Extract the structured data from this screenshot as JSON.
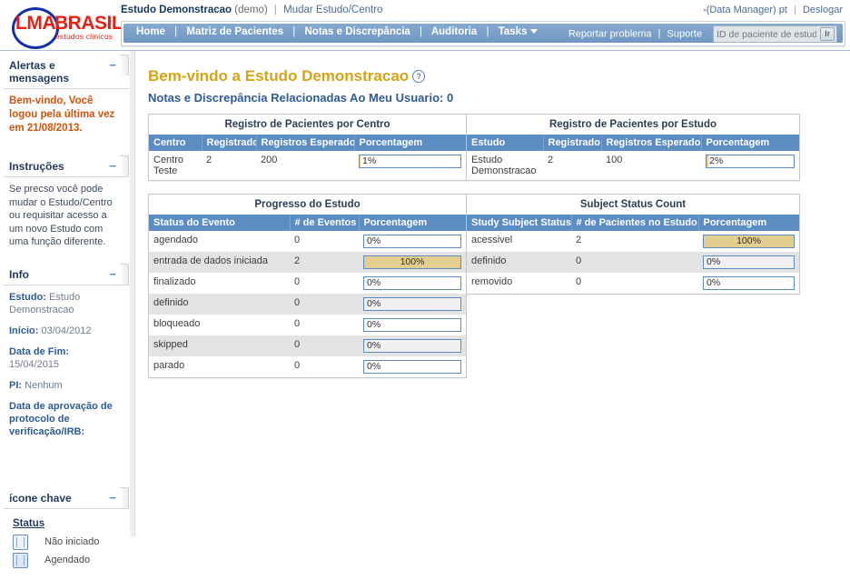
{
  "brand": {
    "logo_main": "LMA",
    "logo_second": "BRASIL",
    "logo_sub": "estudos clinicos",
    "circle_color": "#1231a8",
    "text_color": "#e81f14"
  },
  "header": {
    "study_name": "Estudo Demonstracao",
    "study_demo": "(demo)",
    "separator": "|",
    "change_study_link": "Mudar Estudo/Centro",
    "data_manager": "(Data Manager)",
    "language": "pt",
    "logout": "Deslogar"
  },
  "nav": {
    "items": [
      {
        "label": "Home"
      },
      {
        "label": "Matriz de Pacientes"
      },
      {
        "label": "Notas e Discrepância"
      },
      {
        "label": "Auditoria"
      },
      {
        "label": "Tasks",
        "has_caret": true
      }
    ],
    "separator": "|",
    "report_problem": "Reportar problema",
    "support": "Suporte",
    "search_placeholder": "ID de paciente de estudo",
    "search_value": "",
    "go_label": "Ir"
  },
  "sidebar": {
    "alerts": {
      "title": "Alertas e mensagens",
      "minus": "−",
      "text": "Bem-vindo, Você logou pela última vez em 21/08/2013."
    },
    "instructions": {
      "title": "Instruções",
      "minus": "−",
      "text": "Se precso você pode mudar o Estudo/Centro ou requisitar acesso a um novo Estudo com uma função diferente."
    },
    "info": {
      "title": "Info",
      "minus": "−",
      "rows": [
        {
          "label": "Estudo:",
          "value": "Estudo Demonstracao"
        },
        {
          "label": "Início:",
          "value": "03/04/2012"
        },
        {
          "label": "Data de Fim:",
          "value": "15/04/2015"
        },
        {
          "label": "PI:",
          "value": "Nenhum"
        }
      ],
      "irb_label": "Data de aprovação de protocolo de verificação/IRB:"
    },
    "key": {
      "title": "ícone chave",
      "minus": "−",
      "status_header": "Status",
      "legend": [
        {
          "icon": "not-started-icon",
          "label": "Não iniciado"
        },
        {
          "icon": "scheduled-icon",
          "label": "Agendado"
        }
      ]
    }
  },
  "main": {
    "welcome_title": "Bem-vindo a Estudo Demonstracao",
    "help_icon": "?",
    "subtitle": "Notas e Discrepância Relacionadas Ao Meu Usuario: 0"
  },
  "tables": {
    "by_center": {
      "title": "Registro de Pacientes por Centro",
      "columns": [
        "Centro",
        "Registrado",
        "Registros Esperados",
        "Porcentagem"
      ],
      "rows": [
        {
          "centro": "Centro Teste",
          "registrado": "2",
          "esperados": "200",
          "porcentagem": "1%",
          "pct_value": 1
        }
      ]
    },
    "by_study": {
      "title": "Registro de Pacientes por Estudo",
      "columns": [
        "Estudo",
        "Registrado",
        "Registros Esperados",
        "Porcentagem"
      ],
      "rows": [
        {
          "estudo": "Estudo Demonstracao",
          "registrado": "2",
          "esperados": "100",
          "porcentagem": "2%",
          "pct_value": 2
        }
      ]
    },
    "progress": {
      "title": "Progresso do Estudo",
      "columns": [
        "Status do Evento",
        "# de Eventos",
        "Porcentagem"
      ],
      "rows": [
        {
          "status": "agendado",
          "eventos": "0",
          "porcentagem": "0%",
          "pct_value": 0
        },
        {
          "status": "entrada de dados iniciada",
          "eventos": "2",
          "porcentagem": "100%",
          "pct_value": 100
        },
        {
          "status": "finalizado",
          "eventos": "0",
          "porcentagem": "0%",
          "pct_value": 0
        },
        {
          "status": "definido",
          "eventos": "0",
          "porcentagem": "0%",
          "pct_value": 0
        },
        {
          "status": "bloqueado",
          "eventos": "0",
          "porcentagem": "0%",
          "pct_value": 0
        },
        {
          "status": "skipped",
          "eventos": "0",
          "porcentagem": "0%",
          "pct_value": 0
        },
        {
          "status": "parado",
          "eventos": "0",
          "porcentagem": "0%",
          "pct_value": 0
        }
      ]
    },
    "subject_status": {
      "title": "Subject Status Count",
      "columns": [
        "Study Subject Status",
        "# de Pacientes no Estudo",
        "Porcentagem"
      ],
      "rows": [
        {
          "status": "acessivel",
          "pacientes": "2",
          "porcentagem": "100%",
          "pct_value": 100
        },
        {
          "status": "definido",
          "pacientes": "0",
          "porcentagem": "0%",
          "pct_value": 0
        },
        {
          "status": "removido",
          "pacientes": "0",
          "porcentagem": "0%",
          "pct_value": 0
        }
      ]
    }
  },
  "colors": {
    "nav_blue": "#7aa0c8",
    "table_header_blue": "#5b8cc2",
    "progress_fill": "#e3cd8f",
    "welcome_gold": "#d6a315",
    "alert_orange": "#d4520a",
    "link_blue": "#2e5b93"
  }
}
